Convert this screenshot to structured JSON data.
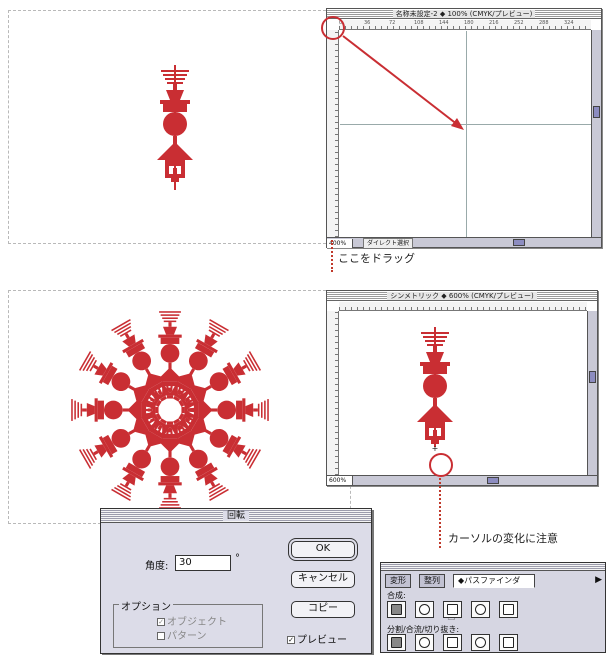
{
  "step1": {
    "window_title": "名称未設定-2 ◆ 100% (CMYK/プレビュー)",
    "ruler_ticks": [
      "0",
      "36",
      "72",
      "108",
      "144",
      "180",
      "216",
      "252",
      "288",
      "324"
    ],
    "zoom": "400%",
    "tool_status": "ダイレクト選択",
    "caption": "ここをドラッグ"
  },
  "step2": {
    "window_title": "シンメトリック ◆ 600% (CMYK/プレビュー)",
    "zoom": "600%",
    "caption": "カーソルの変化に注意"
  },
  "rotate_dialog": {
    "title": "回転",
    "angle_label": "角度:",
    "angle_value": "30",
    "degree_symbol": "°",
    "ok_label": "OK",
    "cancel_label": "キャンセル",
    "copy_label": "コピー",
    "options_label": "オプション",
    "object_label": "オブジェクト",
    "pattern_label": "パターン",
    "preview_label": "プレビュー",
    "object_checked": true,
    "pattern_checked": false,
    "preview_checked": true
  },
  "pathfinder": {
    "tabs": [
      "変形",
      "整列",
      "◆パスファインダ"
    ],
    "combine_label": "合成:",
    "divide_label": "分割/合流/切り抜き:",
    "combine_icons": [
      "unite-icon",
      "intersect-icon",
      "exclude-icon",
      "minus-front-icon",
      "minus-back-icon"
    ],
    "divide_icons": [
      "divide-icon",
      "trim-icon",
      "merge-icon",
      "crop-icon",
      "outline-icon"
    ]
  },
  "colors": {
    "accent_red": "#c92e33",
    "dialog_bg": "#dcdce8",
    "scrollbar": "#8c8cc0"
  }
}
